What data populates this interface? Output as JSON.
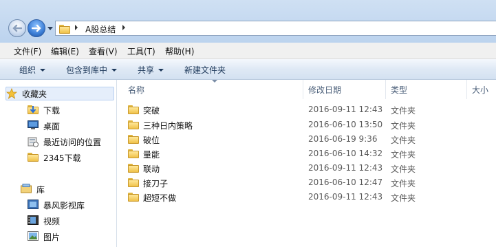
{
  "address": {
    "path": "A股总结"
  },
  "menu": {
    "items": [
      "文件(F)",
      "编辑(E)",
      "查看(V)",
      "工具(T)",
      "帮助(H)"
    ]
  },
  "toolbar": {
    "organize": "组织",
    "include_in_library": "包含到库中",
    "share": "共享",
    "new_folder": "新建文件夹"
  },
  "sidebar": {
    "favorites": {
      "label": "收藏夹",
      "items": [
        {
          "label": "下载",
          "icon": "download-folder-icon"
        },
        {
          "label": "桌面",
          "icon": "desktop-icon"
        },
        {
          "label": "最近访问的位置",
          "icon": "recent-places-icon"
        },
        {
          "label": "2345下载",
          "icon": "folder-icon"
        }
      ]
    },
    "libraries": {
      "label": "库",
      "items": [
        {
          "label": "暴风影视库",
          "icon": "video-library-icon"
        },
        {
          "label": "视频",
          "icon": "video-icon"
        },
        {
          "label": "图片",
          "icon": "picture-icon"
        }
      ]
    }
  },
  "filelist": {
    "columns": {
      "name": "名称",
      "modified": "修改日期",
      "type": "类型",
      "size": "大小"
    },
    "rows": [
      {
        "name": "突破",
        "modified": "2016-09-11 12:43",
        "type": "文件夹"
      },
      {
        "name": "三种日内策略",
        "modified": "2016-06-10 13:50",
        "type": "文件夹"
      },
      {
        "name": "破位",
        "modified": "2016-06-19 9:36",
        "type": "文件夹"
      },
      {
        "name": "量能",
        "modified": "2016-06-10 14:32",
        "type": "文件夹"
      },
      {
        "name": "联动",
        "modified": "2016-09-11 12:43",
        "type": "文件夹"
      },
      {
        "name": "接刀子",
        "modified": "2016-06-10 12:47",
        "type": "文件夹"
      },
      {
        "name": "超短不做",
        "modified": "2016-09-11 12:43",
        "type": "文件夹"
      }
    ]
  },
  "colors": {
    "accent": "#3c7ed6",
    "toolbar_text": "#1e395b",
    "header_text": "#4c607a",
    "folder": "#f0c24a"
  }
}
